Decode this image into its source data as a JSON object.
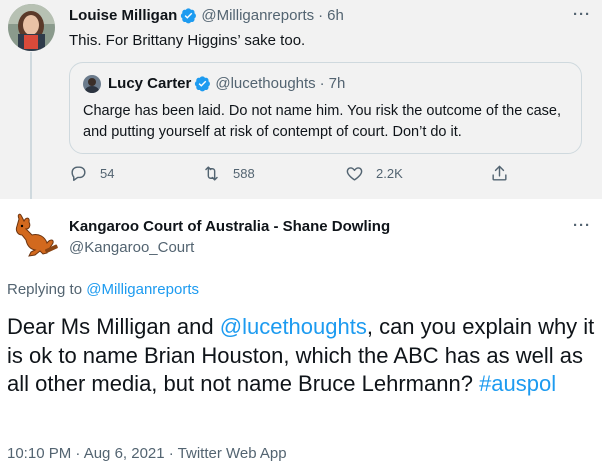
{
  "parent_tweet": {
    "author_name": "Louise Milligan",
    "handle": "@Milliganreports",
    "separator": "·",
    "time": "6h",
    "text": "This. For Brittany Higgins’ sake too.",
    "more_label": "···",
    "quoted_tweet": {
      "author_name": "Lucy Carter",
      "handle": "@lucethoughts",
      "separator": "·",
      "time": "7h",
      "text": "Charge has been laid. Do not name him. You risk the outcome of the case, and putting yourself at risk of contempt of court. Don’t do it."
    },
    "actions": {
      "reply_count": "54",
      "retweet_count": "588",
      "like_count": "2.2K"
    }
  },
  "reply_tweet": {
    "author_name": "Kangaroo Court of Australia - Shane Dowling",
    "handle": "@Kangaroo_Court",
    "more_label": "···",
    "replying_prefix": "Replying to",
    "replying_handle": "@Milliganreports",
    "text_parts": {
      "p1": "Dear Ms Milligan and ",
      "mention": "@lucethoughts",
      "p2": ", can you explain why it is ok to name Brian Houston, which the ABC has as well as all other media, but not name Bruce Lehrmann? ",
      "hashtag": "#auspol"
    },
    "meta": "10:10 PM · Aug 6, 2021 · Twitter Web App"
  },
  "colors": {
    "link": "#1d9bf0",
    "verified": "#1d9bf0",
    "secondary_text": "#536471",
    "parent_background": "#f2f2f2"
  }
}
